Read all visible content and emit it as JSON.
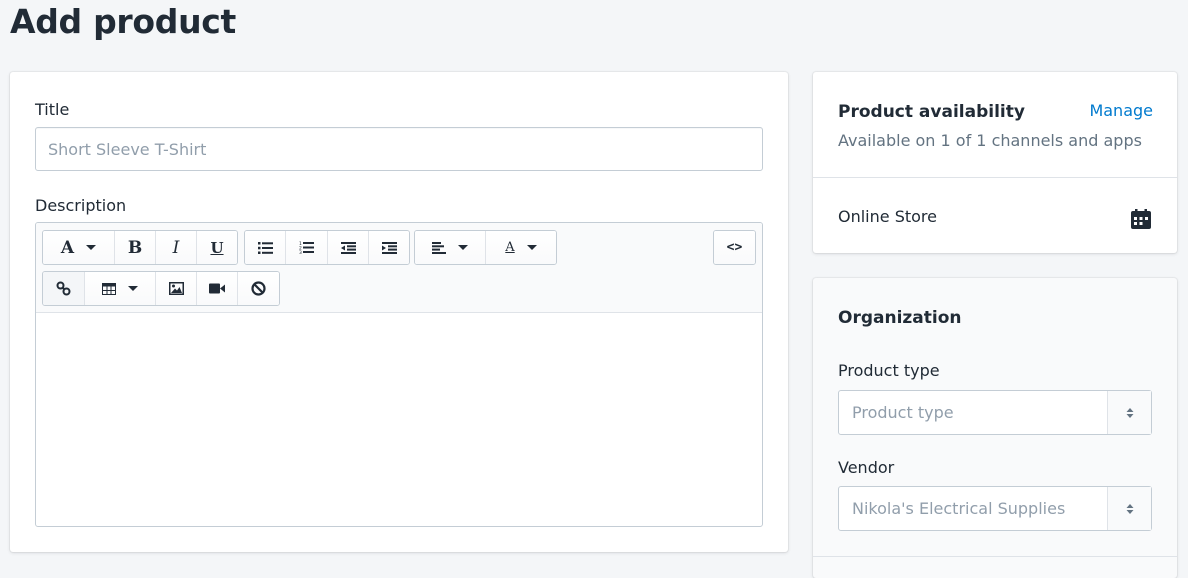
{
  "page": {
    "title": "Add product"
  },
  "main_card": {
    "title_label": "Title",
    "title_placeholder": "Short Sleeve T-Shirt",
    "description_label": "Description",
    "toolbar": {
      "font_label": "A",
      "bold_label": "B",
      "italic_label": "I",
      "underline_label": "U",
      "code_label": "<>",
      "text_color_label": "A",
      "icons": [
        "font-format-icon",
        "bold-icon",
        "italic-icon",
        "underline-icon",
        "bulleted-list-icon",
        "numbered-list-icon",
        "outdent-icon",
        "indent-icon",
        "align-left-icon",
        "text-color-icon",
        "html-code-icon",
        "link-icon",
        "table-icon",
        "image-icon",
        "video-icon",
        "clear-formatting-icon"
      ]
    }
  },
  "availability": {
    "title": "Product availability",
    "manage_label": "Manage",
    "subtitle": "Available on 1 of 1 channels and apps",
    "channel": "Online Store"
  },
  "organization": {
    "title": "Organization",
    "product_type_label": "Product type",
    "product_type_placeholder": "Product type",
    "vendor_label": "Vendor",
    "vendor_placeholder": "Nikola's Electrical Supplies"
  },
  "colors": {
    "accent": "#007ace",
    "text": "#212b36",
    "subdued": "#637381",
    "placeholder": "#919eab"
  }
}
